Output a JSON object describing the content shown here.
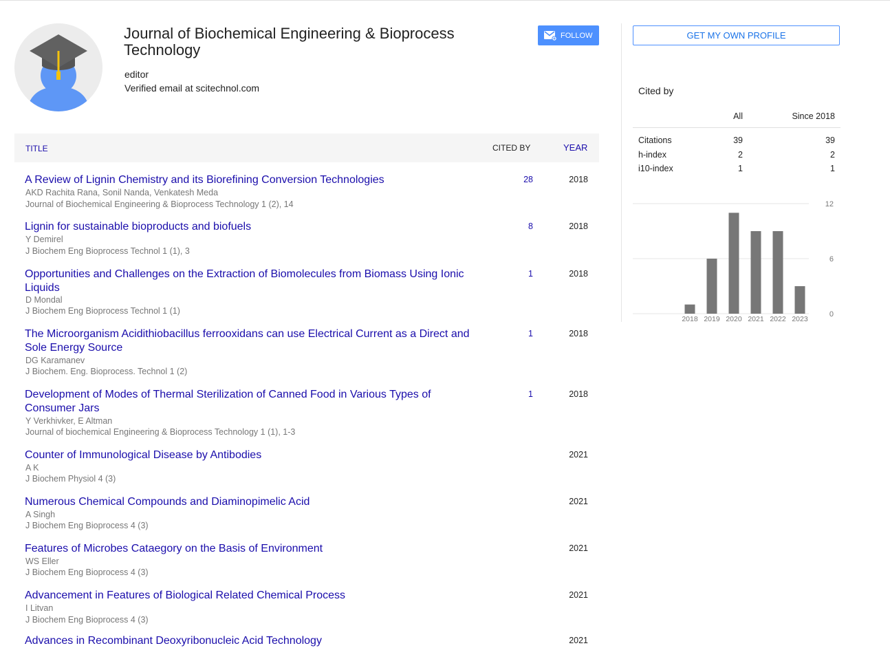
{
  "profile": {
    "name": "Journal of Biochemical Engineering & Bioprocess Technology",
    "affiliation": "editor",
    "email": "Verified email at scitechnol.com",
    "follow_label": "FOLLOW"
  },
  "table": {
    "header_title": "TITLE",
    "header_cited_by": "CITED BY",
    "header_year": "YEAR"
  },
  "articles": [
    {
      "title": "A Review of Lignin Chemistry and its Biorefining Conversion Technologies",
      "authors": "AKD Rachita Rana, Sonil Nanda, Venkatesh Meda",
      "venue": "Journal of Biochemical Engineering & Bioprocess Technology 1 (2), 14",
      "cited_by": "28",
      "year": "2018"
    },
    {
      "title": "Lignin for sustainable bioproducts and biofuels",
      "authors": "Y Demirel",
      "venue": "J Biochem Eng Bioprocess Technol 1 (1), 3",
      "cited_by": "8",
      "year": "2018"
    },
    {
      "title": "Opportunities and Challenges on the Extraction of Biomolecules from Biomass Using Ionic Liquids",
      "authors": "D Mondal",
      "venue": "J Biochem Eng Bioprocess Technol 1 (1)",
      "cited_by": "1",
      "year": "2018"
    },
    {
      "title": "The Microorganism Acidithiobacillus ferrooxidans can use Electrical Current as a Direct and Sole Energy Source",
      "authors": "DG Karamanev",
      "venue": "J Biochem. Eng. Bioprocess. Technol 1 (2)",
      "cited_by": "1",
      "year": "2018"
    },
    {
      "title": "Development of Modes of Thermal Sterilization of Canned Food in Various Types of Consumer Jars",
      "authors": "Y Verkhivker, E Altman",
      "venue": "Journal of biochemical Engineering & Bioprocess Technology 1 (1), 1-3",
      "cited_by": "1",
      "year": "2018"
    },
    {
      "title": "Counter of Immunological Disease by Antibodies",
      "authors": "A K",
      "venue": "J Biochem Physiol 4 (3)",
      "cited_by": "",
      "year": "2021"
    },
    {
      "title": "Numerous Chemical Compounds and Diaminopimelic Acid",
      "authors": "A Singh",
      "venue": "J Biochem Eng Bioprocess 4 (3)",
      "cited_by": "",
      "year": "2021"
    },
    {
      "title": "Features of Microbes Cataegory on the Basis of Environment",
      "authors": "WS Eller",
      "venue": "J Biochem Eng Bioprocess 4 (3)",
      "cited_by": "",
      "year": "2021"
    },
    {
      "title": "Advancement in Features of Biological Related Chemical Process",
      "authors": "I Litvan",
      "venue": "J Biochem Eng Bioprocess 4 (3)",
      "cited_by": "",
      "year": "2021"
    },
    {
      "title": "Advances in Recombinant Deoxyribonucleic Acid Technology",
      "authors": "",
      "venue": "",
      "cited_by": "",
      "year": "2021"
    }
  ],
  "sidebar": {
    "own_profile_label": "GET MY OWN PROFILE",
    "cited_by_heading": "Cited by",
    "col_all": "All",
    "col_since": "Since 2018",
    "stats": [
      {
        "label": "Citations",
        "all": "39",
        "since": "39"
      },
      {
        "label": "h-index",
        "all": "2",
        "since": "2"
      },
      {
        "label": "i10-index",
        "all": "1",
        "since": "1"
      }
    ]
  },
  "colors": {
    "link": "#1a0dab",
    "accent": "#4d90fe",
    "bar": "#777777"
  },
  "icons": {
    "avatar": "graduate-avatar-icon",
    "follow": "envelope-icon"
  },
  "chart_data": {
    "type": "bar",
    "categories": [
      "2018",
      "2019",
      "2020",
      "2021",
      "2022",
      "2023"
    ],
    "values": [
      1,
      6,
      11,
      9,
      9,
      3
    ],
    "ylim": [
      0,
      12
    ],
    "yticks": [
      0,
      6,
      12
    ],
    "yticks_position": "right",
    "grid": true
  }
}
